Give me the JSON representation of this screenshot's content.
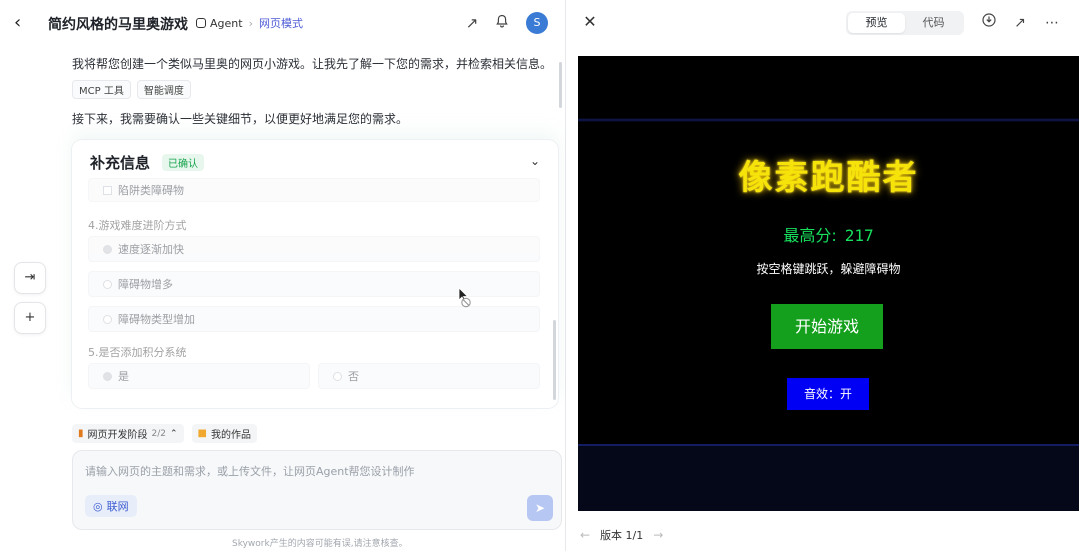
{
  "header": {
    "title": "简约风格的马里奥游戏",
    "agent_label": "Agent",
    "mode_label": "网页模式",
    "avatar_initial": "S"
  },
  "chat": {
    "message_1": "我将帮您创建一个类似马里奥的网页小游戏。让我先了解一下您的需求，并检索相关信息。",
    "tool_1": "MCP 工具",
    "tool_2": "智能调度",
    "message_2": "接下来，我需要确认一些关键细节，以便更好地满足您的需求。"
  },
  "info_card": {
    "title": "补充信息",
    "status_badge": "已确认",
    "option_prev": "陷阱类障碍物",
    "question_4": "4.游戏难度进阶方式",
    "q4_options": [
      "速度逐渐加快",
      "障碍物增多",
      "障碍物类型增加"
    ],
    "question_5": "5.是否添加积分系统",
    "q5_options": [
      "是",
      "否"
    ]
  },
  "chips": {
    "stage_label": "网页开发阶段",
    "stage_count": "2/2",
    "works_label": "我的作品"
  },
  "input": {
    "placeholder": "请输入网页的主题和需求，或上传文件，让网页Agent帮您设计制作",
    "net_label": "联网"
  },
  "footer_note": "Skywork产生的内容可能有误,请注意核查。",
  "preview": {
    "tab_preview": "预览",
    "tab_code": "代码",
    "version_label": "版本 1/1"
  },
  "game": {
    "title": "像素跑酷者",
    "high_score_label": "最高分:",
    "high_score_value": "217",
    "hint": "按空格键跳跃，躲避障碍物",
    "start_button": "开始游戏",
    "sound_button": "音效：开"
  }
}
